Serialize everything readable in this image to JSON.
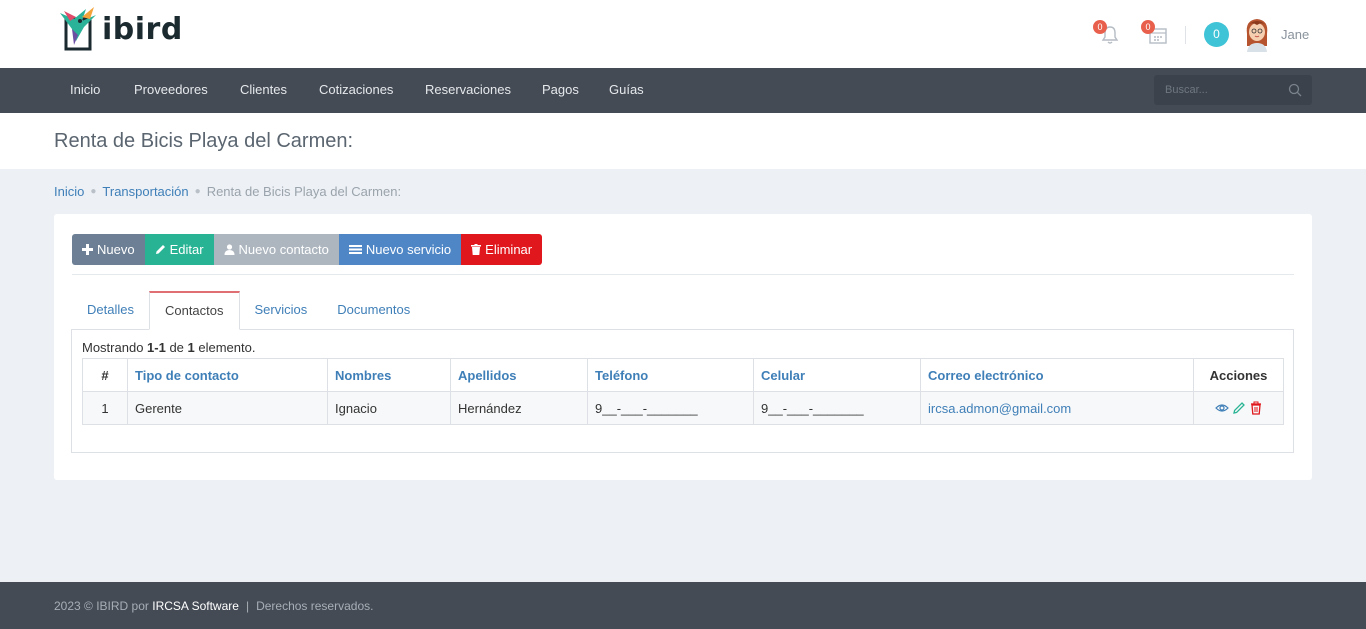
{
  "app": {
    "logo_text": "ibird",
    "notifications_count": "0",
    "calendar_count": "0",
    "counter": "0",
    "username": "Jane"
  },
  "nav": {
    "items": [
      "Inicio",
      "Proveedores",
      "Clientes",
      "Cotizaciones",
      "Reservaciones",
      "Pagos",
      "Guías"
    ],
    "search_placeholder": "Buscar..."
  },
  "page": {
    "title": "Renta de Bicis Playa del Carmen:"
  },
  "breadcrumb": {
    "home": "Inicio",
    "section": "Transportación",
    "current": "Renta de Bicis Playa del Carmen:"
  },
  "toolbar": {
    "nuevo": "Nuevo",
    "editar": "Editar",
    "nuevo_contacto": "Nuevo contacto",
    "nuevo_servicio": "Nuevo servicio",
    "eliminar": "Eliminar"
  },
  "tabs": [
    "Detalles",
    "Contactos",
    "Servicios",
    "Documentos"
  ],
  "active_tab": "Contactos",
  "table": {
    "showing_prefix": "Mostrando ",
    "showing_range": "1-1",
    "showing_mid": " de ",
    "showing_total": "1",
    "showing_suffix": " elemento.",
    "columns": [
      "#",
      "Tipo de contacto",
      "Nombres",
      "Apellidos",
      "Teléfono",
      "Celular",
      "Correo electrónico",
      "Acciones"
    ],
    "rows": [
      {
        "num": "1",
        "tipo": "Gerente",
        "nombres": "Ignacio",
        "apellidos": "Hernández",
        "telefono": "9__-___-_______",
        "celular": "9__-___-_______",
        "correo": "ircsa.admon@gmail.com"
      }
    ]
  },
  "footer": {
    "prefix": "2023 © IBIRD por ",
    "brand": "IRCSA Software",
    "separator": "|",
    "rights": "Derechos reservados."
  },
  "colors": {
    "nav_bg": "#444b55",
    "accent_blue": "#3f7fb8",
    "editar_green": "#28b494",
    "eliminar_red": "#e0171c",
    "badge_red": "#e8604c",
    "counter_teal": "#3fc3d6"
  }
}
